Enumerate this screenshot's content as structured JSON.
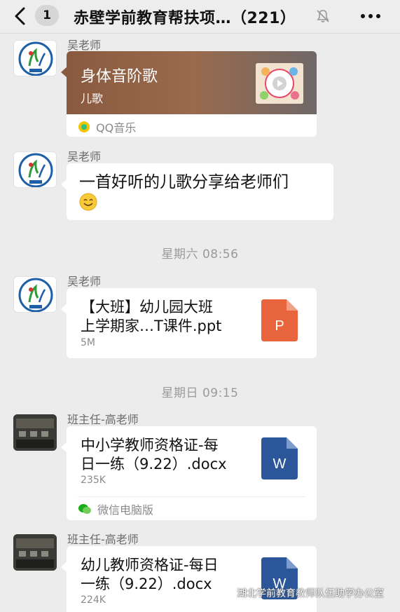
{
  "header": {
    "unread_count": "1",
    "title": "赤壁学前教育帮扶项…（221）"
  },
  "messages": [
    {
      "sender": "吴老师",
      "type": "music",
      "title": "身体音阶歌",
      "subtitle": "儿歌",
      "source": "QQ音乐"
    },
    {
      "sender": "吴老师",
      "type": "text",
      "text": "一首好听的儿歌分享给老师们"
    },
    {
      "time": "星期六 08:56"
    },
    {
      "sender": "吴老师",
      "type": "file",
      "name_line1": "【大班】幼儿园大班",
      "name_line2": "上学期家…T课件.ppt",
      "size": "5M",
      "icon_letter": "P"
    },
    {
      "time": "星期日 09:15"
    },
    {
      "sender": "班主任-高老师",
      "type": "file",
      "name_line1": "中小学教师资格证-每",
      "name_line2": "日一练（9.22）.docx",
      "size": "235K",
      "icon_letter": "W",
      "source": "微信电脑版"
    },
    {
      "sender": "班主任-高老师",
      "type": "file",
      "name_line1": "幼儿教师资格证-每日",
      "name_line2": "一练（9.22）.docx",
      "size": "224K",
      "icon_letter": "W"
    }
  ],
  "watermark": "湖北学前教育教师队伍助学办公室",
  "colors": {
    "ppt_icon": "#e8643c",
    "word_icon": "#2b579a",
    "qq_music": "#f5c400",
    "wechat_green": "#1aad19"
  },
  "icons": [
    "back-icon",
    "mute-icon",
    "more-icon",
    "qq-music-icon",
    "wechat-pc-icon",
    "ppt-file-icon",
    "word-file-icon",
    "emoji-smile-icon"
  ]
}
